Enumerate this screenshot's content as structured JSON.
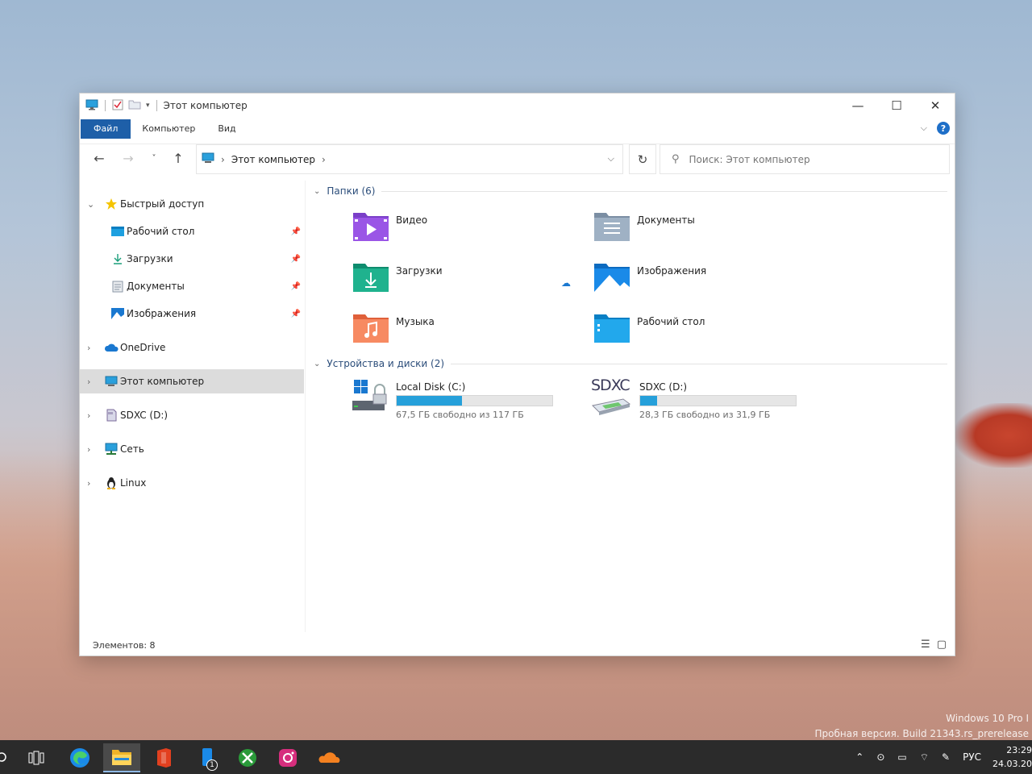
{
  "window": {
    "title": "Этот компьютер",
    "controls": {
      "minimize": "—",
      "maximize": "☐",
      "close": "✕"
    }
  },
  "ribbon": {
    "tabs": [
      "Файл",
      "Компьютер",
      "Вид"
    ],
    "help": "?"
  },
  "navigation": {
    "address": "Этот компьютер",
    "search_placeholder": "Поиск: Этот компьютер"
  },
  "sidebar": {
    "quick_access": "Быстрый доступ",
    "quick_items": [
      "Рабочий стол",
      "Загрузки",
      "Документы",
      "Изображения"
    ],
    "onedrive": "OneDrive",
    "this_pc": "Этот компьютер",
    "sdxc": "SDXC (D:)",
    "network": "Сеть",
    "linux": "Linux"
  },
  "content": {
    "folders_header": "Папки (6)",
    "folders": [
      "Видео",
      "Документы",
      "Загрузки",
      "Изображения",
      "Музыка",
      "Рабочий стол"
    ],
    "drives_header": "Устройства и диски (2)",
    "drives": [
      {
        "name": "Local Disk (C:)",
        "free_text": "67,5 ГБ свободно из 117 ГБ",
        "used_fraction": 0.42
      },
      {
        "name": "SDXC (D:)",
        "free_text": "28,3 ГБ свободно из 31,9 ГБ",
        "used_fraction": 0.11
      }
    ],
    "sdxc_logo": "SDXC"
  },
  "status": {
    "items": "Элементов: 8"
  },
  "desktop": {
    "watermark_line1": "Windows 10 Pro I",
    "watermark_line2": "Пробная версия. Build 21343.rs_prerelease"
  },
  "taskbar": {
    "badge": "1",
    "lang": "РУС",
    "time": "23:29",
    "date": "24.03.20"
  },
  "colors": {
    "accent": "#1e5fa8",
    "drive_bar": "#26a0da",
    "selected": "#dcdcdc"
  }
}
